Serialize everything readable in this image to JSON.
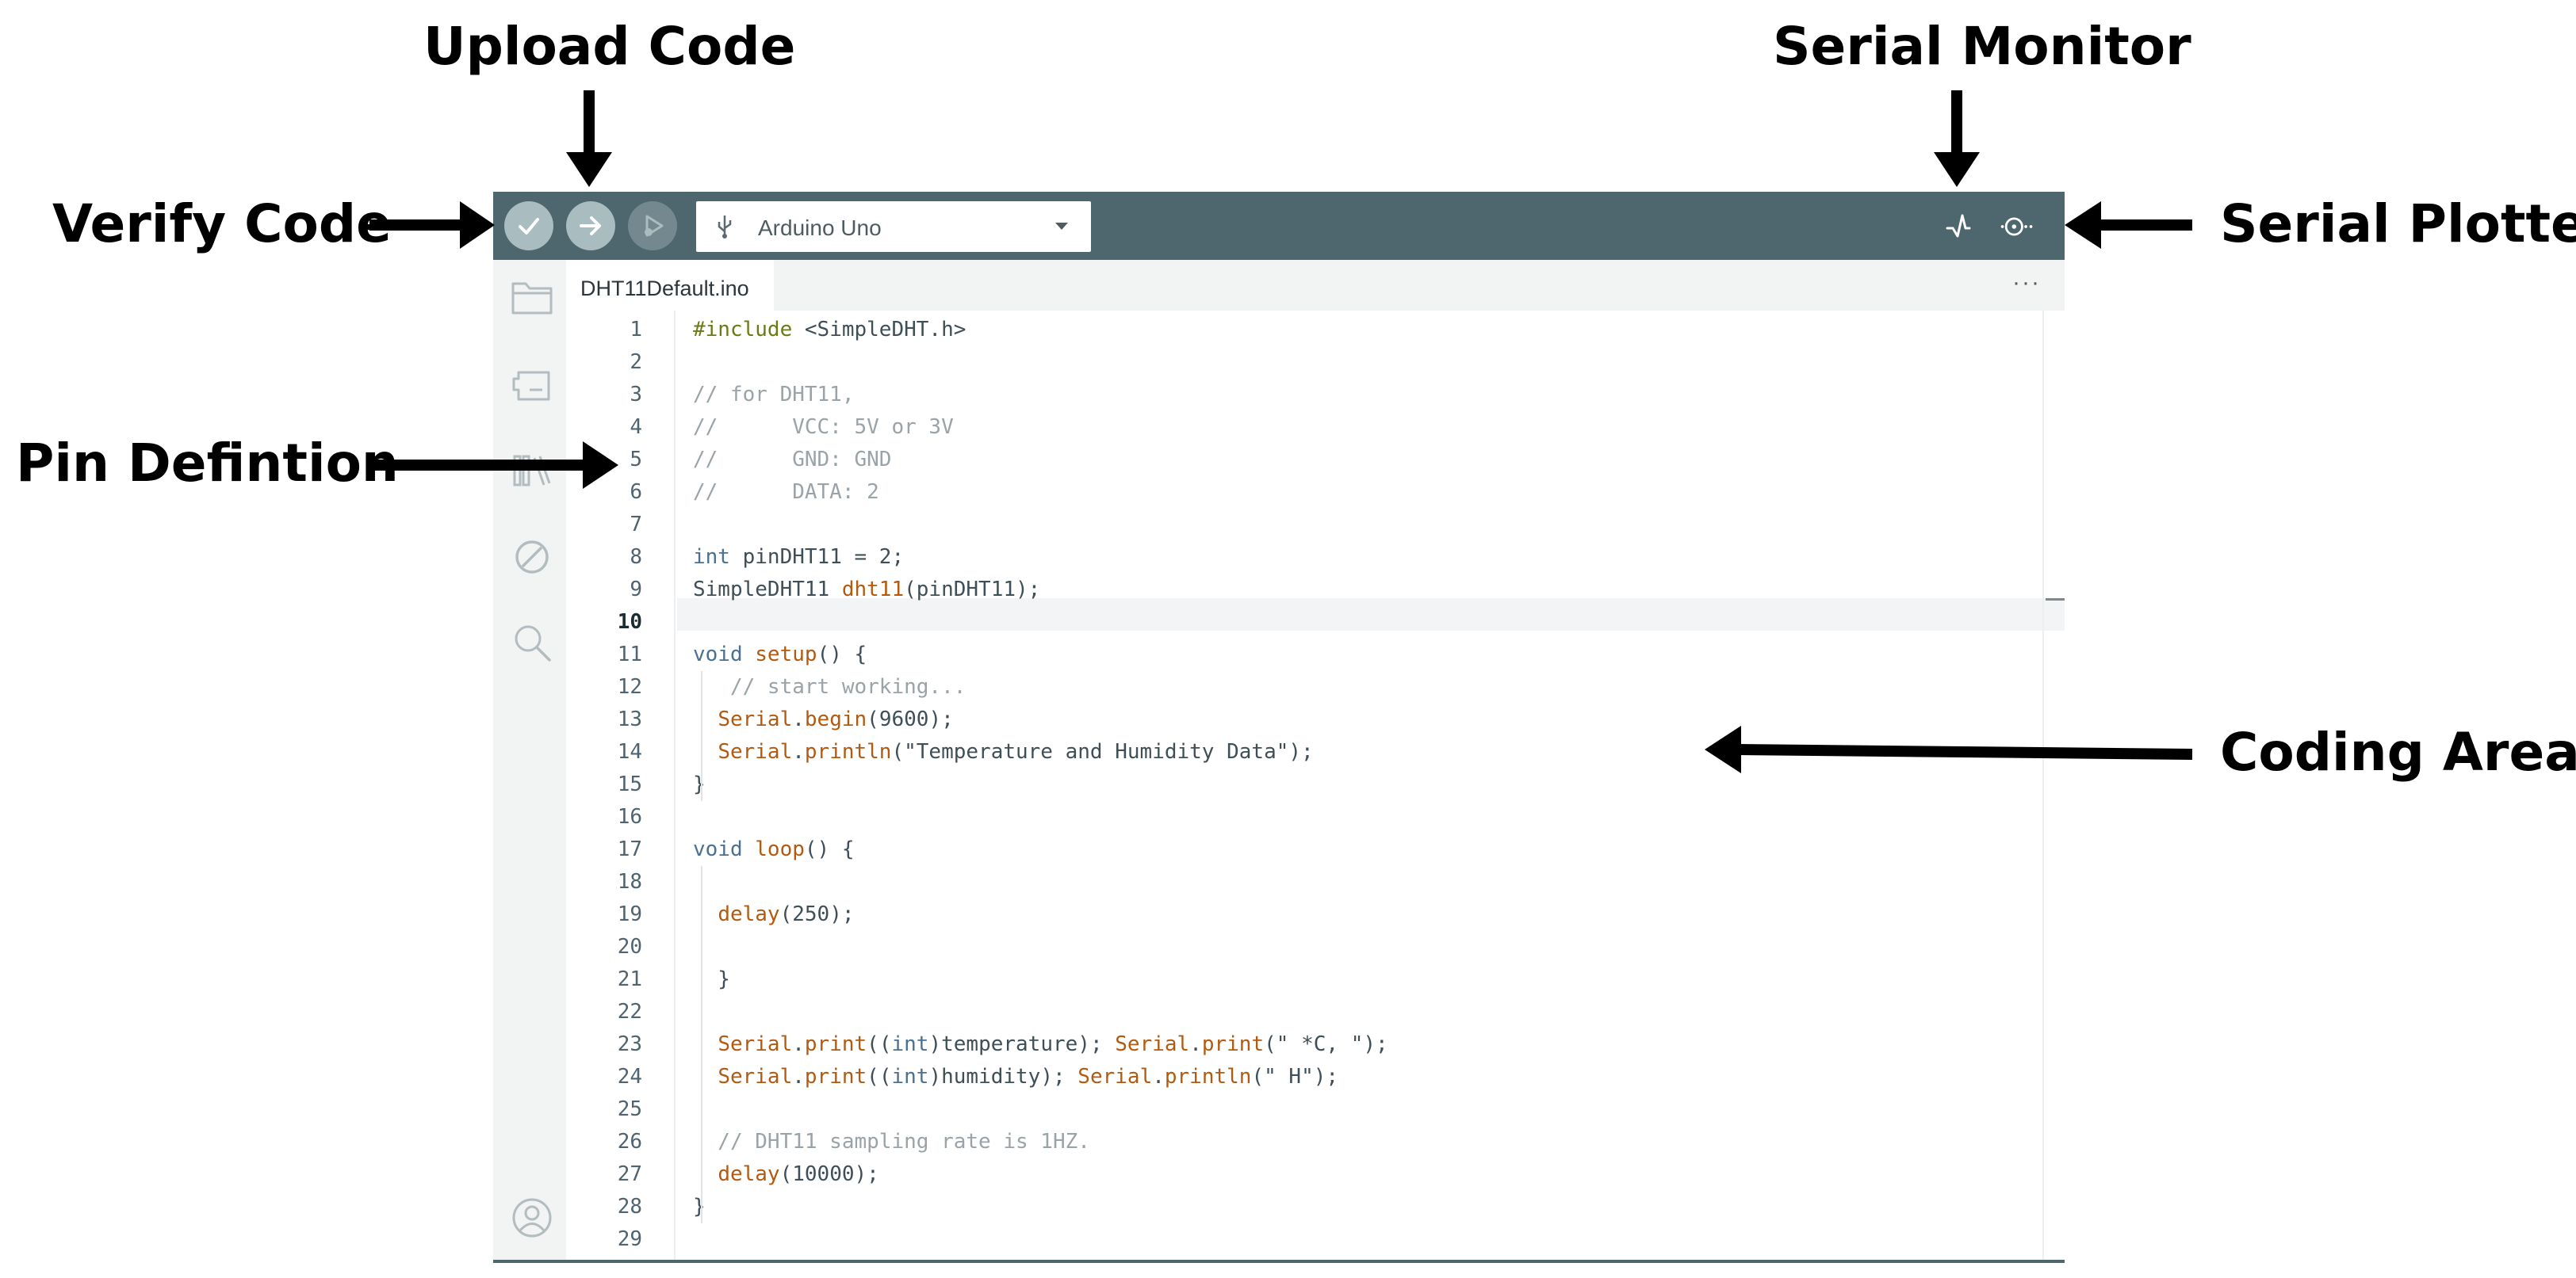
{
  "annotations": {
    "upload_code": "Upload Code",
    "serial_monitor": "Serial Monitor",
    "verify_code": "Verify Code",
    "serial_plotter": "Serial Plotter",
    "pin_definition": "Pin Defintion",
    "coding_area": "Coding Area"
  },
  "toolbar": {
    "board": "Arduino Uno",
    "verify_icon": "check-icon",
    "upload_icon": "arrow-right-icon",
    "debug_icon": "debug-play-icon",
    "monitor_icon": "pulse-icon",
    "plotter_icon": "scope-icon"
  },
  "sidebar": {
    "icons": [
      "folder-icon",
      "board-icon",
      "library-icon",
      "debug-off-icon",
      "search-icon",
      "account-icon"
    ]
  },
  "tab": {
    "filename": "DHT11Default.ino",
    "more": "···"
  },
  "editor": {
    "active_line": 10,
    "line_numbers": [
      "1",
      "2",
      "3",
      "4",
      "5",
      "6",
      "7",
      "8",
      "9",
      "10",
      "11",
      "12",
      "13",
      "14",
      "15",
      "16",
      "17",
      "18",
      "19",
      "20",
      "21",
      "22",
      "23",
      "24",
      "25",
      "26",
      "27",
      "28",
      "29"
    ],
    "lines": [
      [
        {
          "t": "#include",
          "c": "pp"
        },
        {
          "t": " <SimpleDHT.h>",
          "c": "tx"
        }
      ],
      [],
      [
        {
          "t": "// for DHT11,",
          "c": "cm"
        }
      ],
      [
        {
          "t": "//      VCC: 5V or 3V",
          "c": "cm"
        }
      ],
      [
        {
          "t": "//      GND: GND",
          "c": "cm"
        }
      ],
      [
        {
          "t": "//      DATA: 2",
          "c": "cm"
        }
      ],
      [],
      [
        {
          "t": "int",
          "c": "kw"
        },
        {
          "t": " pinDHT11 = 2;",
          "c": "tx"
        }
      ],
      [
        {
          "t": "SimpleDHT11 ",
          "c": "tx"
        },
        {
          "t": "dht11",
          "c": "fn"
        },
        {
          "t": "(pinDHT11);",
          "c": "tx"
        }
      ],
      [],
      [
        {
          "t": "void",
          "c": "kw"
        },
        {
          "t": " ",
          "c": "tx"
        },
        {
          "t": "setup",
          "c": "fn"
        },
        {
          "t": "() {",
          "c": "tx"
        }
      ],
      [
        {
          "t": "   // start working...",
          "c": "cm"
        }
      ],
      [
        {
          "t": "  ",
          "c": "tx"
        },
        {
          "t": "Serial",
          "c": "obj"
        },
        {
          "t": ".",
          "c": "tx"
        },
        {
          "t": "begin",
          "c": "fn"
        },
        {
          "t": "(9600);",
          "c": "tx"
        }
      ],
      [
        {
          "t": "  ",
          "c": "tx"
        },
        {
          "t": "Serial",
          "c": "obj"
        },
        {
          "t": ".",
          "c": "tx"
        },
        {
          "t": "println",
          "c": "fn"
        },
        {
          "t": "(\"Temperature and Humidity Data\");",
          "c": "tx"
        }
      ],
      [
        {
          "t": "}",
          "c": "tx"
        }
      ],
      [],
      [
        {
          "t": "void",
          "c": "kw"
        },
        {
          "t": " ",
          "c": "tx"
        },
        {
          "t": "loop",
          "c": "fn"
        },
        {
          "t": "() {",
          "c": "tx"
        }
      ],
      [],
      [
        {
          "t": "  ",
          "c": "tx"
        },
        {
          "t": "delay",
          "c": "fn"
        },
        {
          "t": "(250);",
          "c": "tx"
        }
      ],
      [],
      [
        {
          "t": "  }",
          "c": "tx"
        }
      ],
      [],
      [
        {
          "t": "  ",
          "c": "tx"
        },
        {
          "t": "Serial",
          "c": "obj"
        },
        {
          "t": ".",
          "c": "tx"
        },
        {
          "t": "print",
          "c": "fn"
        },
        {
          "t": "((",
          "c": "tx"
        },
        {
          "t": "int",
          "c": "kw"
        },
        {
          "t": ")temperature); ",
          "c": "tx"
        },
        {
          "t": "Serial",
          "c": "obj"
        },
        {
          "t": ".",
          "c": "tx"
        },
        {
          "t": "print",
          "c": "fn"
        },
        {
          "t": "(\" *C, \");",
          "c": "tx"
        }
      ],
      [
        {
          "t": "  ",
          "c": "tx"
        },
        {
          "t": "Serial",
          "c": "obj"
        },
        {
          "t": ".",
          "c": "tx"
        },
        {
          "t": "print",
          "c": "fn"
        },
        {
          "t": "((",
          "c": "tx"
        },
        {
          "t": "int",
          "c": "kw"
        },
        {
          "t": ")humidity); ",
          "c": "tx"
        },
        {
          "t": "Serial",
          "c": "obj"
        },
        {
          "t": ".",
          "c": "tx"
        },
        {
          "t": "println",
          "c": "fn"
        },
        {
          "t": "(\" H\");",
          "c": "tx"
        }
      ],
      [],
      [
        {
          "t": "  // DHT11 sampling rate is 1HZ.",
          "c": "cm"
        }
      ],
      [
        {
          "t": "  ",
          "c": "tx"
        },
        {
          "t": "delay",
          "c": "fn"
        },
        {
          "t": "(10000);",
          "c": "tx"
        }
      ],
      [
        {
          "t": "}",
          "c": "tx"
        }
      ],
      []
    ]
  },
  "colors": {
    "toolbar_bg": "#4e666e",
    "button_bg": "#a9bcc0",
    "sidebar_bg": "#f2f4f4",
    "keyword": "#4a7092",
    "function": "#b25a10",
    "comment": "#9aa3a7",
    "preprocessor": "#6b7b14"
  }
}
